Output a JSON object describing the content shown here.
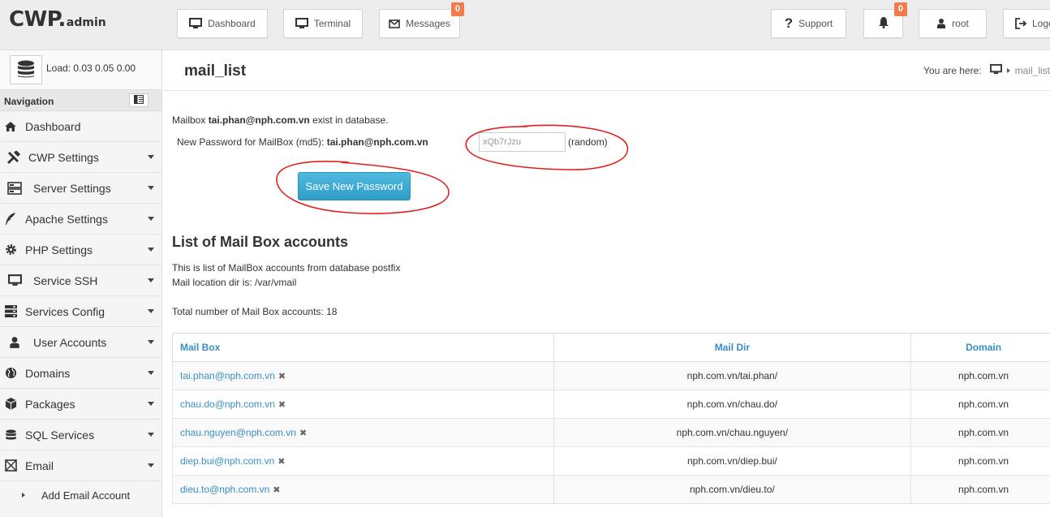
{
  "logo": {
    "main": "CWP.",
    "sub": "admin"
  },
  "topbar": {
    "dashboard": "Dashboard",
    "terminal": "Terminal",
    "messages": "Messages",
    "messages_badge": "0",
    "support": "Support",
    "notifications_badge": "0",
    "user": "root",
    "logout": "Logout"
  },
  "sidebar": {
    "load_label": "Load: 0.03  0.05  0.00",
    "nav_title": "Navigation",
    "items": [
      {
        "label": "Dashboard",
        "icon": "home-icon"
      },
      {
        "label": "CWP Settings",
        "icon": "tools-icon"
      },
      {
        "label": "Server Settings",
        "icon": "server-icon"
      },
      {
        "label": "Apache Settings",
        "icon": "feather-icon"
      },
      {
        "label": "PHP Settings",
        "icon": "gear-icon"
      },
      {
        "label": "Service SSH",
        "icon": "monitor-icon"
      },
      {
        "label": "Services Config",
        "icon": "server-stack-icon"
      },
      {
        "label": "User Accounts",
        "icon": "user-icon"
      },
      {
        "label": "Domains",
        "icon": "globe-icon"
      },
      {
        "label": "Packages",
        "icon": "cubes-icon"
      },
      {
        "label": "SQL Services",
        "icon": "database-icon"
      },
      {
        "label": "Email",
        "icon": "envelope-icon"
      }
    ],
    "sub_item": "Add Email Account"
  },
  "page": {
    "title": "mail_list",
    "breadcrumb_here": "You are here:",
    "breadcrumb_last": "mail_list"
  },
  "form": {
    "exist_prefix": "Mailbox ",
    "exist_email": "tai.phan@nph.com.vn",
    "exist_suffix": " exist in database.",
    "pw_label_prefix": "New Password for MailBox (md5): ",
    "pw_label_email": "tai.phan@nph.com.vn",
    "pw_value": "xQb7rJzu",
    "random_label": "(random)",
    "save_button": "Save New Password"
  },
  "list": {
    "heading": "List of Mail Box accounts",
    "desc1": "This is list of MailBox accounts from database postfix",
    "desc2": "Mail location dir is: /var/vmail",
    "total": "Total number of Mail Box accounts: 18",
    "columns": [
      "Mail Box",
      "Mail Dir",
      "Domain"
    ],
    "rows": [
      {
        "mailbox": "tai.phan@nph.com.vn",
        "dir": "nph.com.vn/tai.phan/",
        "domain": "nph.com.vn"
      },
      {
        "mailbox": "chau.do@nph.com.vn",
        "dir": "nph.com.vn/chau.do/",
        "domain": "nph.com.vn"
      },
      {
        "mailbox": "chau.nguyen@nph.com.vn",
        "dir": "nph.com.vn/chau.nguyen/",
        "domain": "nph.com.vn"
      },
      {
        "mailbox": "diep.bui@nph.com.vn",
        "dir": "nph.com.vn/diep.bui/",
        "domain": "nph.com.vn"
      },
      {
        "mailbox": "dieu.to@nph.com.vn",
        "dir": "nph.com.vn/dieu.to/",
        "domain": "nph.com.vn"
      }
    ]
  },
  "colors": {
    "accent": "#3a8fc6",
    "badge": "#f07b4b",
    "button": "#2f9ec9",
    "annotation": "#e31e1e"
  }
}
